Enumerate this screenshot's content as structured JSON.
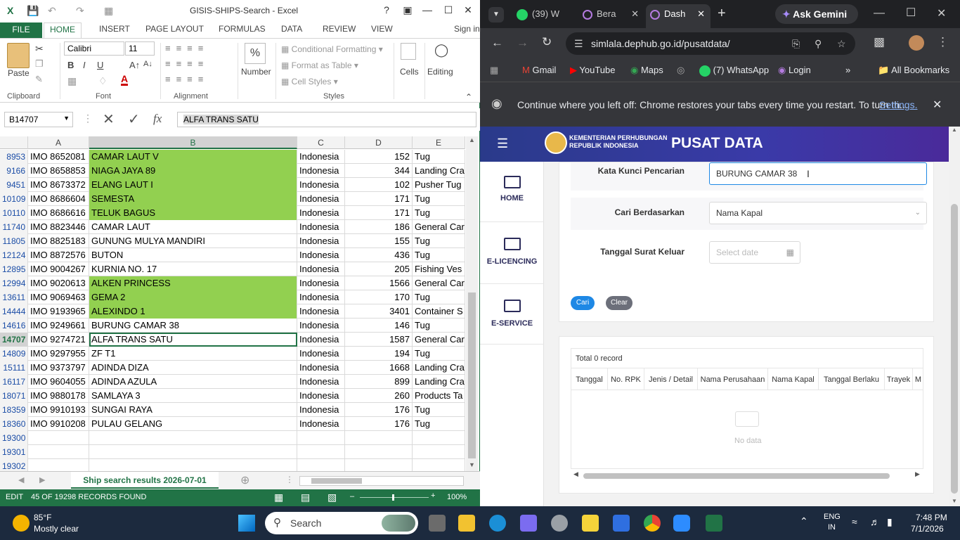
{
  "excel": {
    "title": "GISIS-SHIPS-Search - Excel",
    "ribbon_tabs": [
      "FILE",
      "HOME",
      "INSERT",
      "PAGE LAYOUT",
      "FORMULAS",
      "DATA",
      "REVIEW",
      "VIEW"
    ],
    "sign_in": "Sign in",
    "clipboard": {
      "paste": "Paste",
      "label": "Clipboard"
    },
    "font": {
      "name": "Calibri",
      "size": "11",
      "label": "Font"
    },
    "alignment_label": "Alignment",
    "number": {
      "icon": "%",
      "label": "Number"
    },
    "styles": {
      "conditional": "Conditional Formatting",
      "format_table": "Format as Table",
      "cell_styles": "Cell Styles",
      "label": "Styles"
    },
    "cells": "Cells",
    "editing": "Editing",
    "name_box": "B14707",
    "formula": "ALFA TRANS SATU",
    "columns": [
      "A",
      "B",
      "C",
      "D",
      "E"
    ],
    "rows": [
      {
        "n": "8953",
        "a": "IMO 8652081",
        "b": "CAMAR LAUT V",
        "c": "Indonesia",
        "d": "152",
        "e": "Tug",
        "hl": true
      },
      {
        "n": "9166",
        "a": "IMO 8658853",
        "b": "NIAGA JAYA 89",
        "c": "Indonesia",
        "d": "344",
        "e": "Landing Cra",
        "hl": true
      },
      {
        "n": "9451",
        "a": "IMO 8673372",
        "b": "ELANG LAUT I",
        "c": "Indonesia",
        "d": "102",
        "e": "Pusher Tug",
        "hl": true
      },
      {
        "n": "10109",
        "a": "IMO 8686604",
        "b": "SEMESTA",
        "c": "Indonesia",
        "d": "171",
        "e": "Tug",
        "hl": true
      },
      {
        "n": "10110",
        "a": "IMO 8686616",
        "b": "TELUK BAGUS",
        "c": "Indonesia",
        "d": "171",
        "e": "Tug",
        "hl": true
      },
      {
        "n": "11740",
        "a": "IMO 8823446",
        "b": "CAMAR LAUT",
        "c": "Indonesia",
        "d": "186",
        "e": "General Car",
        "hl": false
      },
      {
        "n": "11805",
        "a": "IMO 8825183",
        "b": "GUNUNG MULYA MANDIRI",
        "c": "Indonesia",
        "d": "155",
        "e": "Tug",
        "hl": false
      },
      {
        "n": "12124",
        "a": "IMO 8872576",
        "b": "BUTON",
        "c": "Indonesia",
        "d": "436",
        "e": "Tug",
        "hl": false
      },
      {
        "n": "12895",
        "a": "IMO 9004267",
        "b": "KURNIA NO. 17",
        "c": "Indonesia",
        "d": "205",
        "e": "Fishing Ves",
        "hl": false
      },
      {
        "n": "12994",
        "a": "IMO 9020613",
        "b": "ALKEN PRINCESS",
        "c": "Indonesia",
        "d": "1566",
        "e": "General Car",
        "hl": true
      },
      {
        "n": "13611",
        "a": "IMO 9069463",
        "b": "GEMA 2",
        "c": "Indonesia",
        "d": "170",
        "e": "Tug",
        "hl": true
      },
      {
        "n": "14444",
        "a": "IMO 9193965",
        "b": "ALEXINDO 1",
        "c": "Indonesia",
        "d": "3401",
        "e": "Container S",
        "hl": true
      },
      {
        "n": "14616",
        "a": "IMO 9249661",
        "b": "BURUNG CAMAR 38",
        "c": "Indonesia",
        "d": "146",
        "e": "Tug",
        "hl": false
      },
      {
        "n": "14707",
        "a": "IMO 9274721",
        "b": "ALFA TRANS SATU",
        "c": "Indonesia",
        "d": "1587",
        "e": "General Car",
        "hl": false,
        "sel": true
      },
      {
        "n": "14809",
        "a": "IMO 9297955",
        "b": "ZF T1",
        "c": "Indonesia",
        "d": "194",
        "e": "Tug",
        "hl": false
      },
      {
        "n": "15111",
        "a": "IMO 9373797",
        "b": "ADINDA DIZA",
        "c": "Indonesia",
        "d": "1668",
        "e": "Landing Cra",
        "hl": false
      },
      {
        "n": "16117",
        "a": "IMO 9604055",
        "b": "ADINDA AZULA",
        "c": "Indonesia",
        "d": "899",
        "e": "Landing Cra",
        "hl": false
      },
      {
        "n": "18071",
        "a": "IMO 9880178",
        "b": "SAMLAYA 3",
        "c": "Indonesia",
        "d": "260",
        "e": "Products Ta",
        "hl": false
      },
      {
        "n": "18359",
        "a": "IMO 9910193",
        "b": "SUNGAI RAYA",
        "c": "Indonesia",
        "d": "176",
        "e": "Tug",
        "hl": false
      },
      {
        "n": "18360",
        "a": "IMO 9910208",
        "b": "PULAU GELANG",
        "c": "Indonesia",
        "d": "176",
        "e": "Tug",
        "hl": false
      },
      {
        "n": "19300",
        "a": "",
        "b": "",
        "c": "",
        "d": "",
        "e": "",
        "hl": false
      },
      {
        "n": "19301",
        "a": "",
        "b": "",
        "c": "",
        "d": "",
        "e": "",
        "hl": false
      },
      {
        "n": "19302",
        "a": "",
        "b": "",
        "c": "",
        "d": "",
        "e": "",
        "hl": false
      }
    ],
    "sheet_tab": "Ship search results 2026-07-01",
    "status_mode": "EDIT",
    "status_text": "45 OF 19298 RECORDS FOUND",
    "zoom": "100%"
  },
  "chrome": {
    "tabs": [
      {
        "label": "(39) W",
        "badge": "39"
      },
      {
        "label": "Bera"
      },
      {
        "label": "Dash"
      }
    ],
    "ask_gemini": "Ask Gemini",
    "url": "simlala.dephub.go.id/pusatdata/",
    "bookmarks": [
      "Gmail",
      "YouTube",
      "Maps",
      "(7) WhatsApp",
      "Login"
    ],
    "bookmark_badge": "39",
    "all_bookmarks": "All Bookmarks",
    "infobar_text": "Continue where you left off: Chrome restores your tabs every time you restart. To turn th...",
    "infobar_link": "Settings."
  },
  "site": {
    "ministry_line1": "KEMENTERIAN PERHUBUNGAN",
    "ministry_line2": "REPUBLIK INDONESIA",
    "brand": "PUSAT DATA",
    "side_items": [
      "HOME",
      "E-LICENCING",
      "E-SERVICE"
    ],
    "form": {
      "keyword_label": "Kata Kunci Pencarian",
      "keyword_value": "BURUNG CAMAR 38",
      "search_by_label": "Cari Berdasarkan",
      "search_by_value": "Nama Kapal",
      "date_label": "Tanggal Surat Keluar",
      "date_placeholder": "Select date",
      "search_button": "Cari",
      "clear_button": "Clear"
    },
    "results": {
      "total": "Total 0 record",
      "columns": [
        "Tanggal",
        "No. RPK",
        "Jenis / Detail",
        "Nama Perusahaan",
        "Nama Kapal",
        "Tanggal Berlaku",
        "Trayek",
        "M"
      ],
      "empty": "No data"
    }
  },
  "taskbar": {
    "temp": "85°F",
    "weather": "Mostly clear",
    "search": "Search",
    "lang1": "ENG",
    "lang2": "IN",
    "time": "7:48 PM",
    "date": "7/1/2026"
  }
}
